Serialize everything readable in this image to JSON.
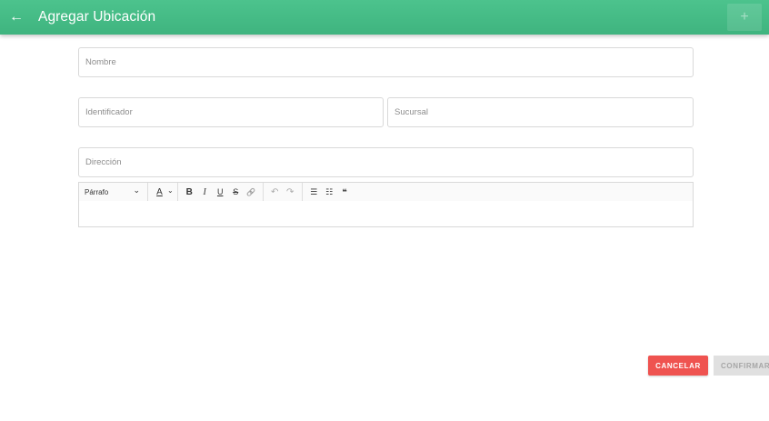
{
  "header": {
    "title": "Agregar Ubicación",
    "back_icon": "←",
    "add_icon": "+"
  },
  "form": {
    "nombre": {
      "placeholder": "Nombre",
      "value": ""
    },
    "identificador": {
      "placeholder": "Identificador",
      "value": ""
    },
    "sucursal": {
      "placeholder": "Sucursal",
      "value": ""
    },
    "direccion": {
      "placeholder": "Dirección",
      "value": ""
    }
  },
  "editor": {
    "paragraph_select": "Párrafo",
    "chevron": "⌄",
    "font_color": "A",
    "bold": "B",
    "italic": "I",
    "underline": "U",
    "strikethrough": "S",
    "link": "🔗",
    "undo": "↶",
    "redo": "↷",
    "bullet_list": "☰",
    "numbered_list": "☷",
    "blockquote": "❝"
  },
  "actions": {
    "cancel_label": "CANCELAR",
    "confirm_label": "CONFIRMAR"
  },
  "colors": {
    "header": "#43b883",
    "cancel": "#ef5350",
    "confirm_disabled": "#e0e0e0"
  }
}
